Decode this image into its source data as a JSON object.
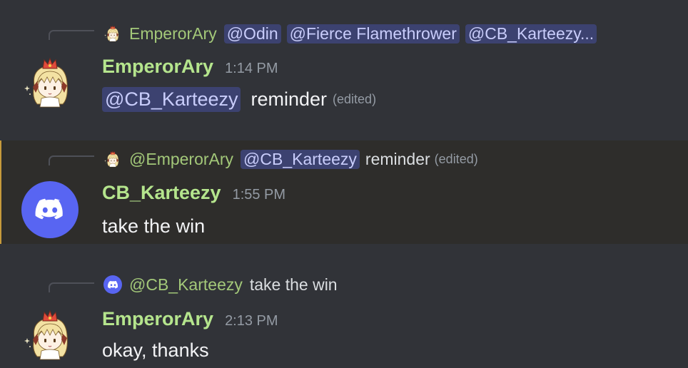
{
  "messages": [
    {
      "reply": {
        "author": "EmperorAry",
        "mentions": [
          "@Odin",
          "@Fierce Flamethrower",
          "@CB_Karteezy..."
        ],
        "text": ""
      },
      "author": "EmperorAry",
      "time": "1:14 PM",
      "mention": "@CB_Karteezy",
      "text": "reminder",
      "edited": "(edited)"
    },
    {
      "reply": {
        "author": "@EmperorAry",
        "mentions": [
          "@CB_Karteezy"
        ],
        "text": "reminder",
        "edited": "(edited)"
      },
      "author": "CB_Karteezy",
      "time": "1:55 PM",
      "text": "take the win"
    },
    {
      "reply": {
        "author": "@CB_Karteezy",
        "text": "take the win"
      },
      "author": "EmperorAry",
      "time": "2:13 PM",
      "text": "okay, thanks"
    }
  ],
  "icons": {
    "emperor_avatar": "anime-girl-crown-avatar",
    "discord_avatar": "discord-logo-avatar"
  },
  "colors": {
    "background": "#313338",
    "highlight_bg": "#2e2d2b",
    "highlight_bar": "#c79a3b",
    "username": "#b5e58d",
    "mention_bg": "#3c4270",
    "discord_blurple": "#5865f2"
  }
}
